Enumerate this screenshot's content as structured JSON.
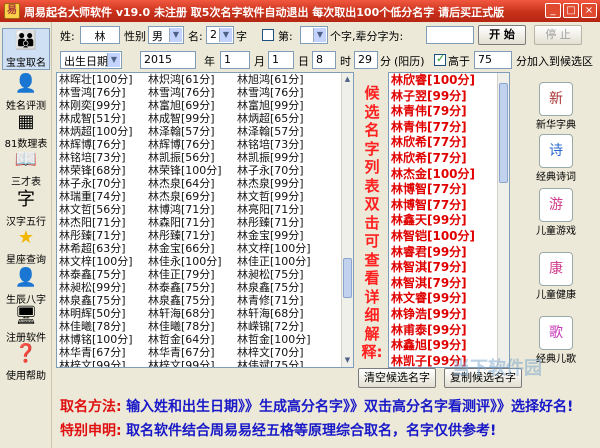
{
  "window": {
    "title": "周易起名大师软件 v19.0  未注册   取5次名字软件自动退出  每次取出100个低分名字 请后买正式版",
    "icon_glyph": "易",
    "controls": [
      "_",
      "□",
      "×"
    ]
  },
  "sidebar": {
    "items": [
      {
        "label": "宝宝取名",
        "icon": "baby-icon",
        "glyph": "👪"
      },
      {
        "label": "姓名评测",
        "icon": "person-icon",
        "glyph": "👤"
      },
      {
        "label": "81数理表",
        "icon": "table-icon",
        "glyph": "▦"
      },
      {
        "label": "三才表",
        "icon": "book-icon",
        "glyph": "📖"
      },
      {
        "label": "汉字五行",
        "icon": "characters-icon",
        "glyph": "字"
      },
      {
        "label": "星座查询",
        "icon": "star-icon",
        "glyph": "★"
      },
      {
        "label": "生辰八字",
        "icon": "user-icon",
        "glyph": "👤"
      },
      {
        "label": "注册软件",
        "icon": "register-icon",
        "glyph": "🖥"
      },
      {
        "label": "使用帮助",
        "icon": "help-icon",
        "glyph": "❓"
      }
    ]
  },
  "form": {
    "surname_label": "姓:",
    "surname_value": "林",
    "gender_label": "性别",
    "gender_value": "男",
    "name_label": "名:",
    "name_count_value": "2",
    "name_count_unit": "字",
    "di_label": "第:",
    "di_unit": "个字,辈分字为:",
    "generation_value": "",
    "start_button": "开 始",
    "stop_button": "停 止",
    "date_type_value": "出生日期",
    "year_value": "2015",
    "year_unit": "年",
    "month_value": "1",
    "month_unit": "月",
    "day_value": "1",
    "day_unit": "日",
    "hour_value": "8",
    "hour_unit": "时",
    "minute_value": "29",
    "minute_unit": "分",
    "calendar_label": "(阳历)",
    "higher_label": "高于",
    "higher_value": "75",
    "higher_suffix": "分加入到候选区",
    "higher_checked": true
  },
  "name_columns": [
    [
      "林晖壮[100分]",
      "林雪鸿[76分]",
      "林刚奕[99分]",
      "林成智[51分]",
      "林炳超[100分]",
      "林辉博[76分]",
      "林铭培[73分]",
      "林荣锋[68分]",
      "林子永[70分]",
      "林瑞重[74分]",
      "林文哲[56分]",
      "林杰阳[71分]",
      "林彤臻[71分]",
      "林希超[63分]",
      "林文梓[100分]",
      "林泰鑫[75分]",
      "林昶松[99分]",
      "林泉鑫[75分]",
      "林明辉[50分]",
      "林佳曦[78分]",
      "林博铭[100分]",
      "林华青[67分]",
      "林梓文[99分]",
      "林鑫晔[99分]",
      "林凯甫[99分]"
    ],
    [
      "林炽鸿[61分]",
      "林雪鸿[76分]",
      "林富旭[69分]",
      "林成智[99分]",
      "林泽翰[57分]",
      "林辉博[76分]",
      "林凯振[56分]",
      "林荣锋[100分]",
      "林杰泉[64分]",
      "林杰泉[69分]",
      "林博鸿[71分]",
      "林森阳[71分]",
      "林彤臻[71分]",
      "林金宝[66分]",
      "林佳永[100分]",
      "林佳正[79分]",
      "林泰鑫[75分]",
      "林泉鑫[75分]",
      "林轩海[68分]",
      "林佳曦[78分]",
      "林哲金[64分]",
      "林华青[67分]",
      "林梓文[99分]",
      "林鑫晔[99分]",
      "林凯甫[75分]"
    ],
    [
      "林旭鸿[61分]",
      "林雪鸿[76分]",
      "林富旭[99分]",
      "林炳超[65分]",
      "林泽翰[57分]",
      "林铭培[73分]",
      "林凯振[99分]",
      "林子永[70分]",
      "林杰泉[99分]",
      "林文哲[99分]",
      "林亮阳[71分]",
      "林彤臻[71分]",
      "林金宝[99分]",
      "林文梓[100分]",
      "林佳正[100分]",
      "林昶松[75分]",
      "林泉鑫[75分]",
      "林青修[71分]",
      "林轩海[68分]",
      "林嵘锦[72分]",
      "林哲金[100分]",
      "林梓文[70分]",
      "林伟斌[75分]",
      "林凯甫[75分]"
    ]
  ],
  "note_text": "候选名字列表双击可查看详细解释:",
  "candidates": [
    "林欣睿[100分]",
    "林子翌[99分]",
    "林青伟[79分]",
    "林青伟[77分]",
    "林欣希[77分]",
    "林欣希[77分]",
    "林杰金[100分]",
    "林博智[77分]",
    "林博智[77分]",
    "林鑫天[99分]",
    "林智铠[100分]",
    "林睿君[99分]",
    "林智淇[79分]",
    "林智淇[79分]",
    "林文睿[99分]",
    "林铮浩[99分]",
    "林甫泰[99分]",
    "林鑫旭[99分]",
    "林凯子[99分]",
    "林锦晖[78分]",
    "林锦晖[78分]",
    "林淇慧[99分]"
  ],
  "buttons": {
    "clear": "清空候选名字",
    "copy": "复制候选名字"
  },
  "rightbar": {
    "items": [
      {
        "label": "新华字典",
        "icon": "dictionary-icon",
        "glyph": "新"
      },
      {
        "label": "经典诗词",
        "icon": "poetry-icon",
        "glyph": "诗"
      },
      {
        "label": "儿童游戏",
        "icon": "game-icon",
        "glyph": "游"
      },
      {
        "label": "儿童健康",
        "icon": "health-icon",
        "glyph": "康"
      },
      {
        "label": "经典儿歌",
        "icon": "song-icon",
        "glyph": "歌"
      }
    ]
  },
  "footer": {
    "method_label": "取名方法:",
    "method_text": "输入姓和出生日期》》生成高分名字》》双击高分名字看测评》》选择好名!",
    "notice_label": "特别申明:",
    "notice_text": "取名软件结合周易易经五格等原理综合取名，名字仅供参考!"
  },
  "watermark_text": "当下软件园"
}
